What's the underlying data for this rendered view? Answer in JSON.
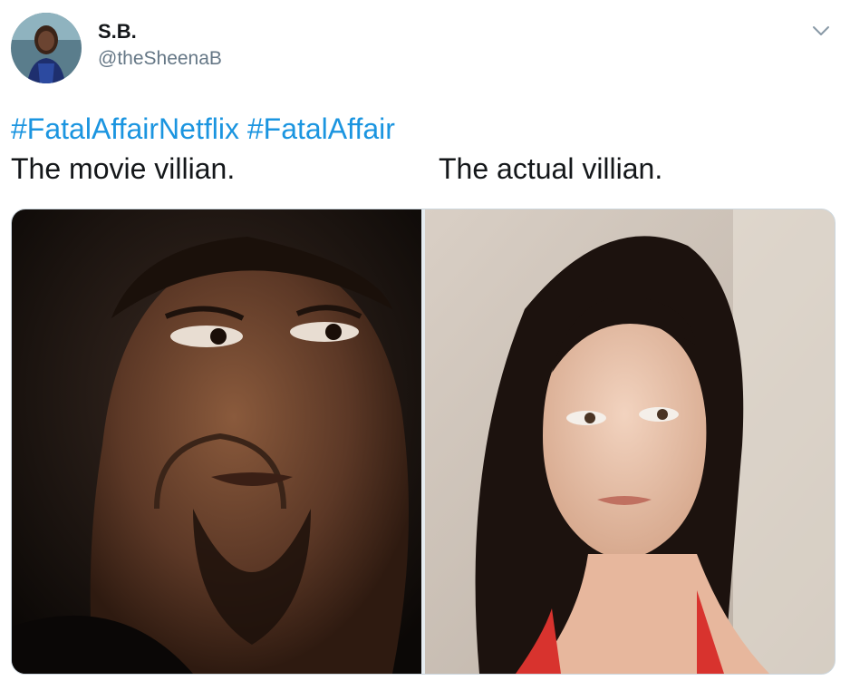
{
  "author": {
    "display_name": "S.B.",
    "handle": "@theSheenaB"
  },
  "tweet": {
    "hashtags": [
      "#FatalAffairNetflix",
      "#FatalAffair"
    ],
    "caption_left": "The movie villian.",
    "caption_right": "The actual villian."
  },
  "media": {
    "left_photo": "man-portrait",
    "right_photo": "woman-portrait"
  },
  "colors": {
    "hashtag": "#1b95e0",
    "text": "#14171a",
    "secondary": "#657786"
  },
  "icons": {
    "menu": "chevron-down-icon"
  }
}
